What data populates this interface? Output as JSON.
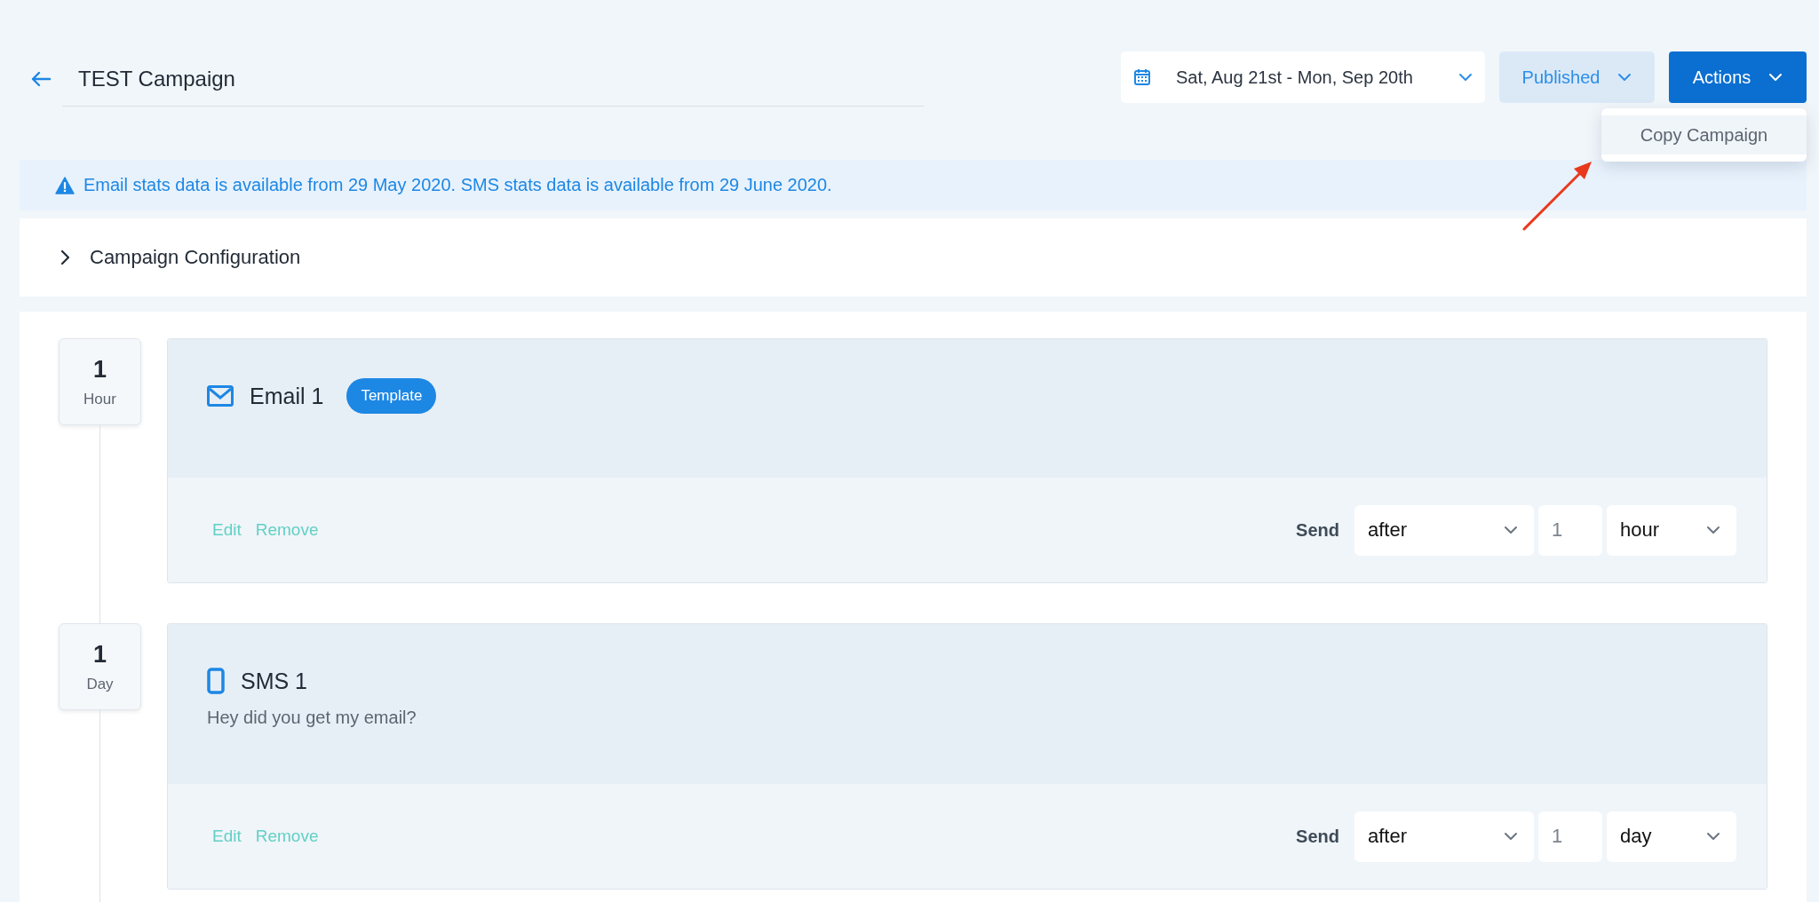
{
  "header": {
    "title": "TEST Campaign",
    "date_range": "Sat, Aug 21st - Mon, Sep 20th",
    "status_button": "Published",
    "actions_button": "Actions",
    "actions_menu": [
      {
        "label": "Copy Campaign",
        "selected": true
      }
    ]
  },
  "notice": "Email stats data is available from 29 May 2020. SMS stats data is available from 29 June 2020.",
  "config_section": {
    "label": "Campaign Configuration",
    "expanded": false
  },
  "steps": [
    {
      "delay_value": "1",
      "delay_unit": "Hour",
      "kind": "email",
      "title": "Email 1",
      "badge": "Template",
      "actions": [
        "Edit",
        "Remove"
      ],
      "send": {
        "label": "Send",
        "timing": "after",
        "amount": "1",
        "unit": "hour"
      }
    },
    {
      "delay_value": "1",
      "delay_unit": "Day",
      "kind": "sms",
      "title": "SMS 1",
      "message": "Hey did you get my email?",
      "actions": [
        "Edit",
        "Remove"
      ],
      "send": {
        "label": "Send",
        "timing": "after",
        "amount": "1",
        "unit": "day"
      }
    }
  ]
}
